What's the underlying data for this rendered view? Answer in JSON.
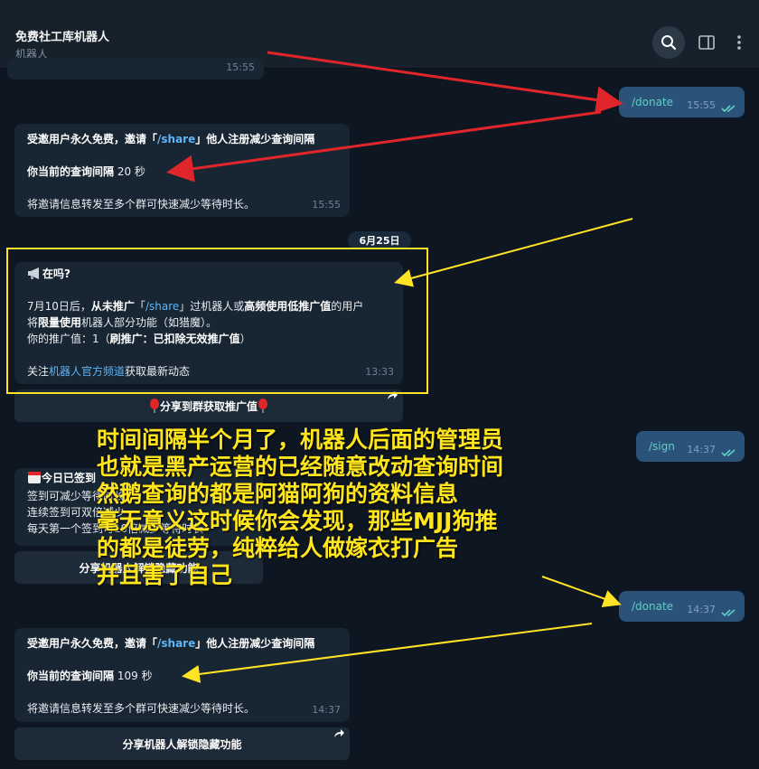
{
  "header": {
    "title": "免费社工库机器人",
    "subtitle": "机器人"
  },
  "messages": {
    "truncated_time": "15:55",
    "donate1": {
      "text": "/donate",
      "time": "15:55"
    },
    "share1": {
      "pre": "受邀用户永久免费，邀请「",
      "cmd": "/share",
      "post": "」他人注册减少查询间隔",
      "interval_label": "你当前的查询间隔",
      "interval_value": "20 秒",
      "note": "将邀请信息转发至多个群可快速减少等待时长。",
      "time": "15:55"
    },
    "date_separator": "6月25日",
    "announce": {
      "title": "在吗?",
      "l1a": "7月10日后，",
      "l1b": "从未推广",
      "l1c": "「",
      "l1cmd": "/share",
      "l1d": "」过机器人或",
      "l1e": "高频使用低推广值",
      "l1f": "的用户",
      "l2a": "将",
      "l2b": "限量使用",
      "l2c": "机器人部分功能（如猎魔）。",
      "l3a": "你的推广值：1（",
      "l3b": "刷推广：已扣除无效推广值",
      "l3c": "）",
      "l4a": "关注",
      "l4link": "机器人官方频道",
      "l4b": "获取最新动态",
      "time": "13:33"
    },
    "share_group_button": "分享到群获取推广值",
    "sign": {
      "text": "/sign",
      "time": "14:37"
    },
    "signin": {
      "title": "今日已签到",
      "l1": "签到可减少等待时长",
      "l2": "连续签到可双倍减少",
      "l3": "每天第一个签到可10倍减少等待时长"
    },
    "unlock_button": "分享机器人解锁隐藏功能",
    "donate2": {
      "text": "/donate",
      "time": "14:37"
    },
    "share2": {
      "pre": "受邀用户永久免费，邀请「",
      "cmd": "/share",
      "post": "」他人注册减少查询间隔",
      "interval_label": "你当前的查询间隔",
      "interval_value": "109 秒",
      "note": "将邀请信息转发至多个群可快速减少等待时长。",
      "time": "14:37"
    },
    "unlock_button2": "分享机器人解锁隐藏功能"
  },
  "overlay_text": [
    "时间间隔半个月了，机器人后面的管理员",
    "也就是黑产运营的已经随意改动查询时间",
    "然鹅查询的都是阿猫阿狗的资料信息",
    "毫无意义这时候你会发现，那些MJJ狗推",
    "的都是徒劳，纯粹给人做嫁衣打广告",
    "并且害了自己"
  ],
  "colors": {
    "annotation_red": "#e0262b",
    "annotation_yellow": "#ffe324",
    "outgoing_bubble": "#2b5278",
    "incoming_bubble": "#182533"
  },
  "icons": [
    "search-icon",
    "sidebar-panel-icon",
    "more-vertical-icon",
    "read-checks-icon",
    "forward-arrow-icon",
    "megaphone-icon",
    "balloon-icon",
    "calendar-icon"
  ]
}
